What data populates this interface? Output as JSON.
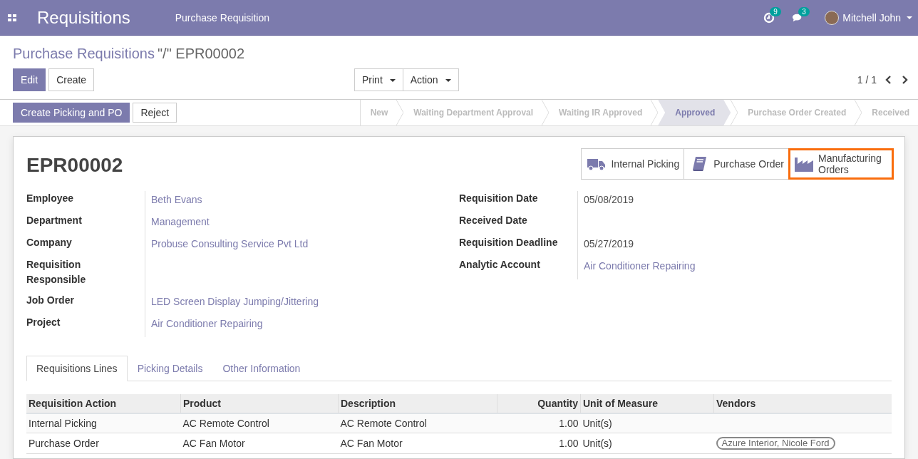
{
  "navbar": {
    "app_title": "Requisitions",
    "menu": "Purchase Requisition",
    "activity_count": "9",
    "message_count": "3",
    "user": "Mitchell John"
  },
  "breadcrumb": {
    "parent": "Purchase Requisitions",
    "separator": "\"/\"",
    "current": "EPR00002"
  },
  "buttons": {
    "edit": "Edit",
    "create": "Create",
    "print": "Print",
    "action": "Action"
  },
  "pager": "1 / 1",
  "status_buttons": [
    {
      "label": "Create Picking and PO",
      "kind": "primary"
    },
    {
      "label": "Reject",
      "kind": "secondary"
    }
  ],
  "stages": [
    {
      "label": "New",
      "selected": false
    },
    {
      "label": "Waiting Department Approval",
      "selected": false
    },
    {
      "label": "Waiting IR Approved",
      "selected": false
    },
    {
      "label": "Approved",
      "selected": true
    },
    {
      "label": "Purchase Order Created",
      "selected": false
    },
    {
      "label": "Received",
      "selected": false
    }
  ],
  "record_title": "EPR00002",
  "smart_buttons": [
    {
      "label": "Internal Picking",
      "kind": "truck",
      "highlighted": false
    },
    {
      "label": "Purchase Order",
      "kind": "book",
      "highlighted": false
    },
    {
      "label": "Manufacturing Orders",
      "kind": "factory",
      "highlighted": true
    }
  ],
  "left_fields": [
    {
      "label": "Employee",
      "value": "Beth Evans",
      "kind": "link"
    },
    {
      "label": "Department",
      "value": "Management",
      "kind": "link"
    },
    {
      "label": "Company",
      "value": "Probuse Consulting Service Pvt Ltd",
      "kind": "link"
    },
    {
      "label": "Requisition Responsible",
      "kind": "empty"
    },
    {
      "label": "Job Order",
      "value": "LED Screen Display Jumping/Jittering",
      "kind": "link"
    },
    {
      "label": "Project",
      "value": "Air Conditioner Repairing",
      "kind": "link"
    }
  ],
  "right_fields": [
    {
      "label": "Requisition Date",
      "value": "05/08/2019",
      "kind": "text"
    },
    {
      "label": "Received Date",
      "kind": "empty"
    },
    {
      "label": "Requisition Deadline",
      "value": "05/27/2019",
      "kind": "text"
    },
    {
      "label": "Analytic Account",
      "value": "Air Conditioner Repairing",
      "kind": "link"
    }
  ],
  "tabs": [
    {
      "label": "Requisitions Lines",
      "selected": true
    },
    {
      "label": "Picking Details",
      "selected": false
    },
    {
      "label": "Other Information",
      "selected": false
    }
  ],
  "table": {
    "columns": [
      "Requisition Action",
      "Product",
      "Description",
      "Quantity",
      "Unit of Measure",
      "Vendors"
    ],
    "rows": [
      {
        "action": "Internal Picking",
        "product": "AC Remote Control",
        "description": "AC Remote Control",
        "quantity": "1.00",
        "uom": "Unit(s)",
        "vendors": []
      },
      {
        "action": "Purchase Order",
        "product": "AC Fan Motor",
        "description": "AC Fan Motor",
        "quantity": "1.00",
        "uom": "Unit(s)",
        "vendors": [
          "Azure Interior, Nicole Ford"
        ]
      }
    ]
  }
}
